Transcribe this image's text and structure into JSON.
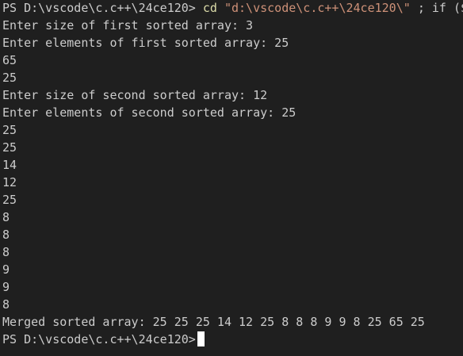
{
  "terminal": {
    "cmd_prompt": "PS D:\\vscode\\c.c++\\24ce120>",
    "cmd_keyword": "cd",
    "cmd_path": "\"d:\\vscode\\c.c++\\24ce120\\\"",
    "cmd_rest": "; if ($",
    "lines": [
      "Enter size of first sorted array: 3",
      "Enter elements of first sorted array: 25",
      "65",
      "25",
      "Enter size of second sorted array: 12",
      "Enter elements of second sorted array: 25",
      "25",
      "25",
      "14",
      "12",
      "25",
      "8",
      "8",
      "8",
      "9",
      "9",
      "8",
      "Merged sorted array: 25 25 25 14 12 25 8 8 8 9 9 8 25 65 25"
    ],
    "final_prompt": "PS D:\\vscode\\c.c++\\24ce120>"
  },
  "colors": {
    "background": "#1f1f1f",
    "text": "#cccccc",
    "command": "#dcdcaa",
    "string": "#ce9178",
    "cursor": "#ffffff"
  }
}
